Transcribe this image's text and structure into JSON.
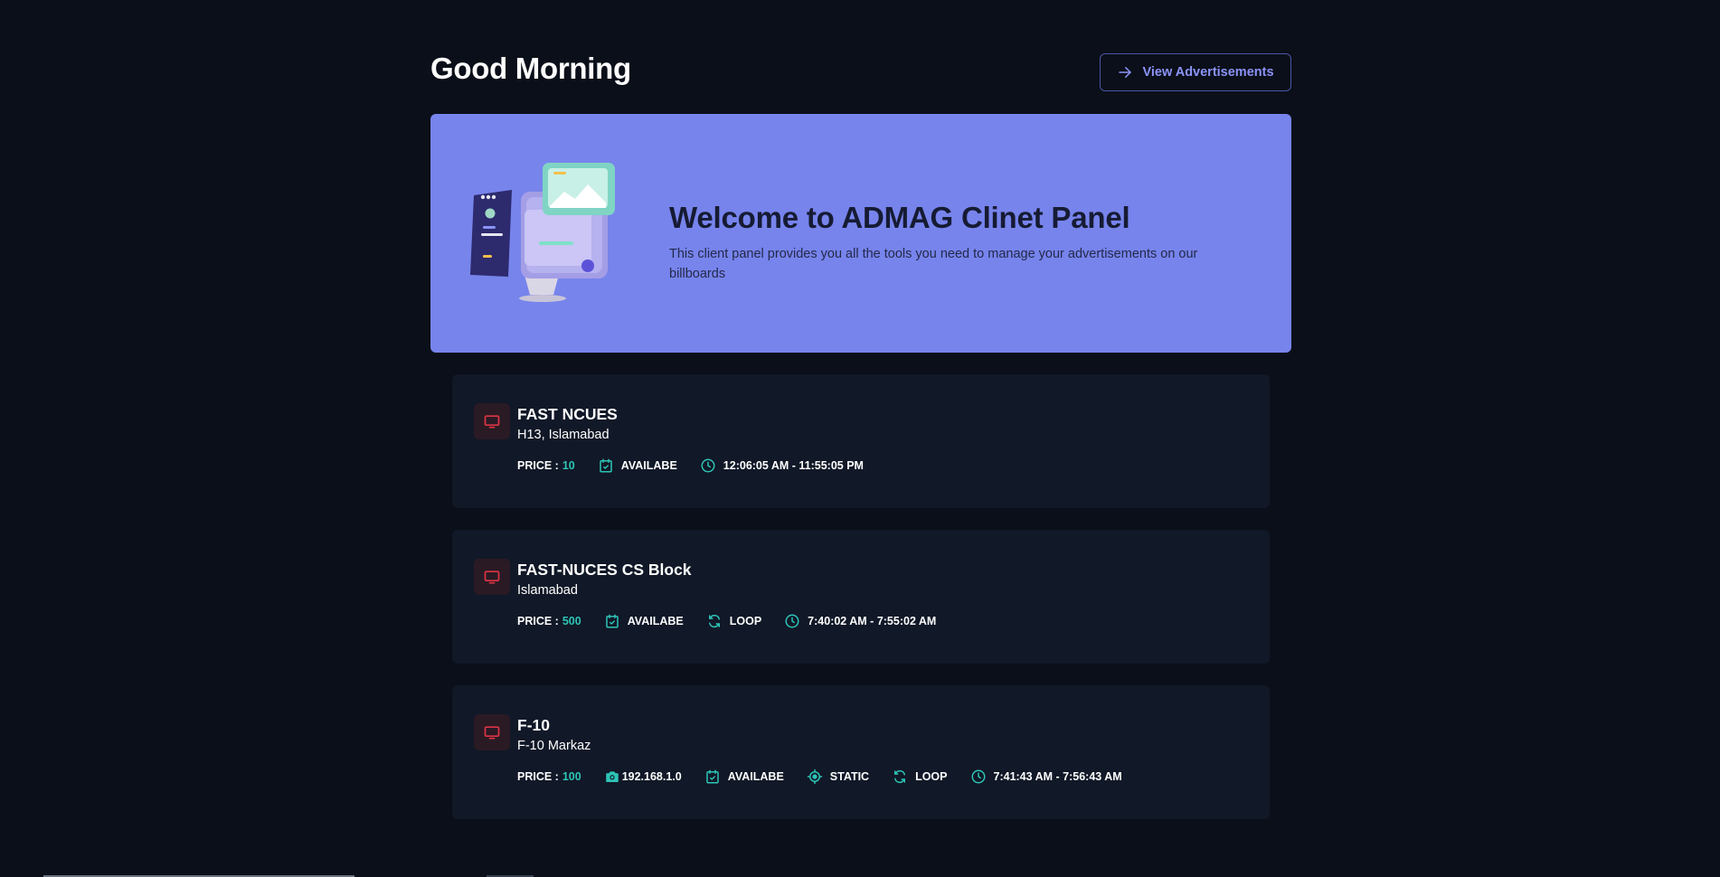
{
  "header": {
    "greeting": "Good Morning",
    "view_ads_label": "View Advertisements",
    "view_ads_icon": "arrow-right-icon"
  },
  "banner": {
    "title": "Welcome to ADMAG Clinet Panel",
    "description": "This client panel provides you all the tools you need to manage your advertisements on our billboards",
    "illustration": "monitor-illustration"
  },
  "colors": {
    "background": "#0b0f19",
    "card": "#111827",
    "banner": "#7784ec",
    "accent": "#2ec4b6",
    "primary": "#8b93f8",
    "danger": "#dc3545"
  },
  "billboards": [
    {
      "title": "FAST NCUES",
      "location": "H13, Islamabad",
      "price_label": "PRICE :",
      "price_value": "10",
      "status": "AVAILABE",
      "time_range": "12:06:05 AM - 11:55:05 PM"
    },
    {
      "title": "FAST-NUCES CS Block",
      "location": "Islamabad",
      "price_label": "PRICE :",
      "price_value": "500",
      "status": "AVAILABE",
      "mode": "LOOP",
      "time_range": "7:40:02 AM - 7:55:02 AM"
    },
    {
      "title": "F-10",
      "location": "F-10 Markaz",
      "price_label": "PRICE :",
      "price_value": "100",
      "camera_ip": "192.168.1.0",
      "status": "AVAILABE",
      "type": "STATIC",
      "mode": "LOOP",
      "time_range": "7:41:43 AM - 7:56:43 AM"
    }
  ]
}
